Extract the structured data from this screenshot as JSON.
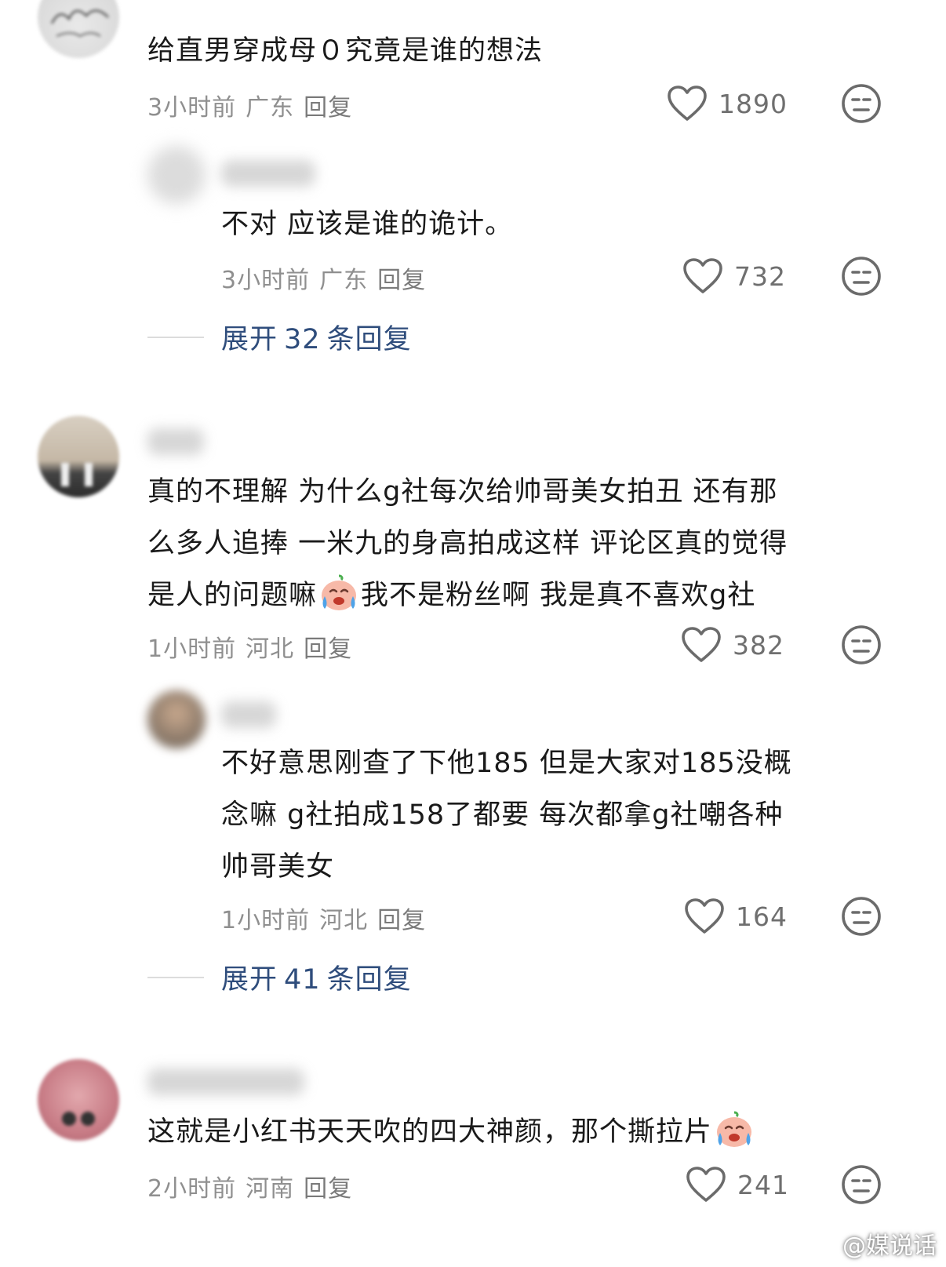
{
  "comments": [
    {
      "text_lines": [
        "给直男穿成母０究竟是谁的想法"
      ],
      "time": "3小时前",
      "region": "广东",
      "reply_label": "回复",
      "likes": "1890",
      "reply": {
        "text_lines": [
          "不对 应该是谁的诡计。"
        ],
        "time": "3小时前",
        "region": "广东",
        "reply_label": "回复",
        "likes": "732"
      },
      "expand": {
        "prefix": "展开",
        "count": "32",
        "suffix": "条回复"
      }
    },
    {
      "text_lines": [
        "真的不理解 为什么g社每次给帅哥美女拍丑 还有那",
        "么多人追捧 一米九的身高拍成这样 评论区真的觉得",
        "是人的问题嘛",
        "我不是粉丝啊 我是真不喜欢g社"
      ],
      "time": "1小时前",
      "region": "河北",
      "reply_label": "回复",
      "likes": "382",
      "reply": {
        "text_lines": [
          "不好意思刚查了下他185 但是大家对185没概",
          "念嘛  g社拍成158了都要 每次都拿g社嘲各种",
          "帅哥美女"
        ],
        "time": "1小时前",
        "region": "河北",
        "reply_label": "回复",
        "likes": "164"
      },
      "expand": {
        "prefix": "展开",
        "count": "41",
        "suffix": "条回复"
      }
    },
    {
      "text_lines": [
        "这就是小红书天天吹的四大神颜，那个撕拉片"
      ],
      "time": "2小时前",
      "region": "河南",
      "reply_label": "回复",
      "likes": "241"
    }
  ],
  "icons": {
    "like": "heart-outline-icon",
    "dislike": "neutral-face-icon",
    "emoji": "crying-emoji-icon",
    "watermark": "weibo-logo-icon"
  },
  "watermark": "@媒说话",
  "colors": {
    "text": "#1a1a1a",
    "meta": "#8f8f8f",
    "expand_link": "#2f4d7c",
    "background": "#ffffff"
  }
}
